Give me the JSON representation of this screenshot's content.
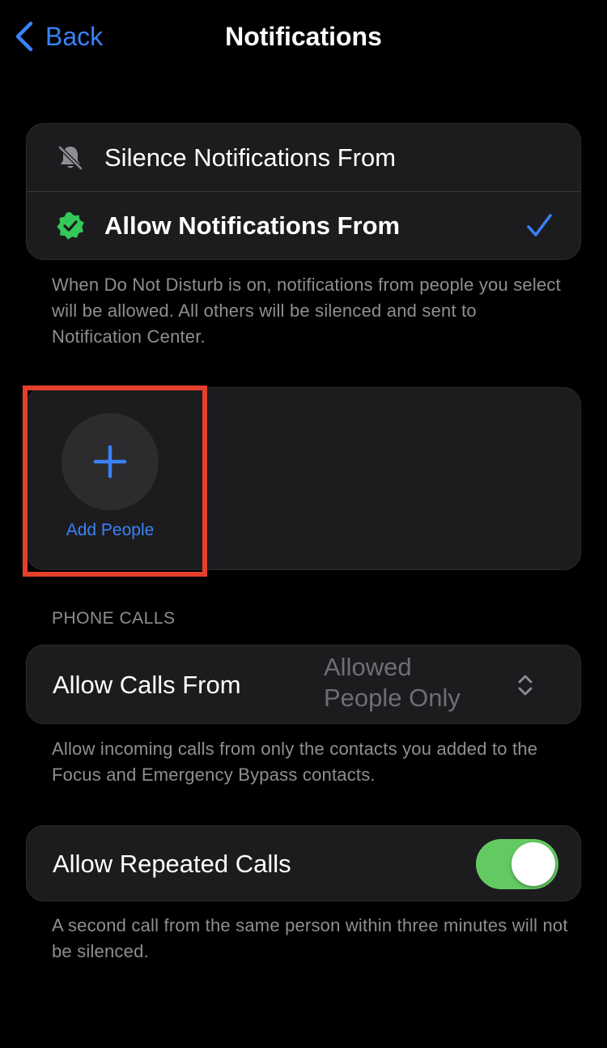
{
  "nav": {
    "back_label": "Back",
    "title": "Notifications"
  },
  "notification_mode": {
    "options": [
      {
        "label": "Silence Notifications From",
        "icon": "bell-slash-icon",
        "selected": false
      },
      {
        "label": "Allow Notifications From",
        "icon": "verified-badge-icon",
        "selected": true
      }
    ],
    "description": "When Do Not Disturb is on, notifications from people you select will be allowed. All others will be silenced and sent to Notification Center."
  },
  "people": {
    "add_label": "Add People",
    "add_icon": "plus-icon",
    "highlight_color": "#e5402b"
  },
  "phone_calls": {
    "section_header": "PHONE CALLS",
    "allow_calls_label": "Allow Calls From",
    "allow_calls_value": "Allowed People Only",
    "allow_calls_description": "Allow incoming calls from only the contacts you added to the Focus and Emergency Bypass contacts.",
    "repeated_calls_label": "Allow Repeated Calls",
    "repeated_calls_enabled": true,
    "repeated_calls_description": "A second call from the same person within three minutes will not be silenced."
  },
  "colors": {
    "accent": "#3a82f7",
    "toggle_on": "#63c961",
    "badge_green": "#34c759"
  }
}
